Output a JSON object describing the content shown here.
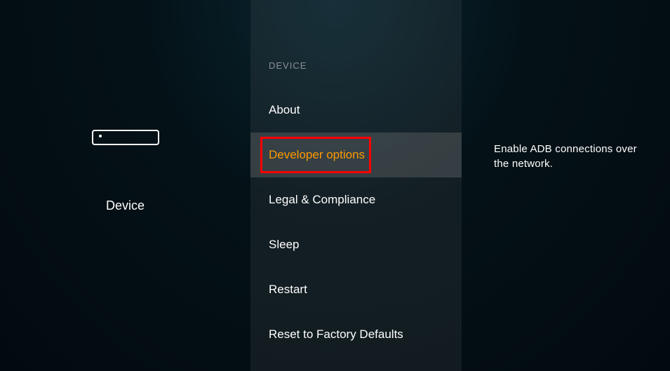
{
  "left": {
    "label": "Device"
  },
  "middle": {
    "section_header": "DEVICE",
    "items": [
      {
        "label": "About",
        "selected": false
      },
      {
        "label": "Developer options",
        "selected": true
      },
      {
        "label": "Legal & Compliance",
        "selected": false
      },
      {
        "label": "Sleep",
        "selected": false
      },
      {
        "label": "Restart",
        "selected": false
      },
      {
        "label": "Reset to Factory Defaults",
        "selected": false
      }
    ]
  },
  "right": {
    "description": "Enable ADB connections over the network."
  }
}
